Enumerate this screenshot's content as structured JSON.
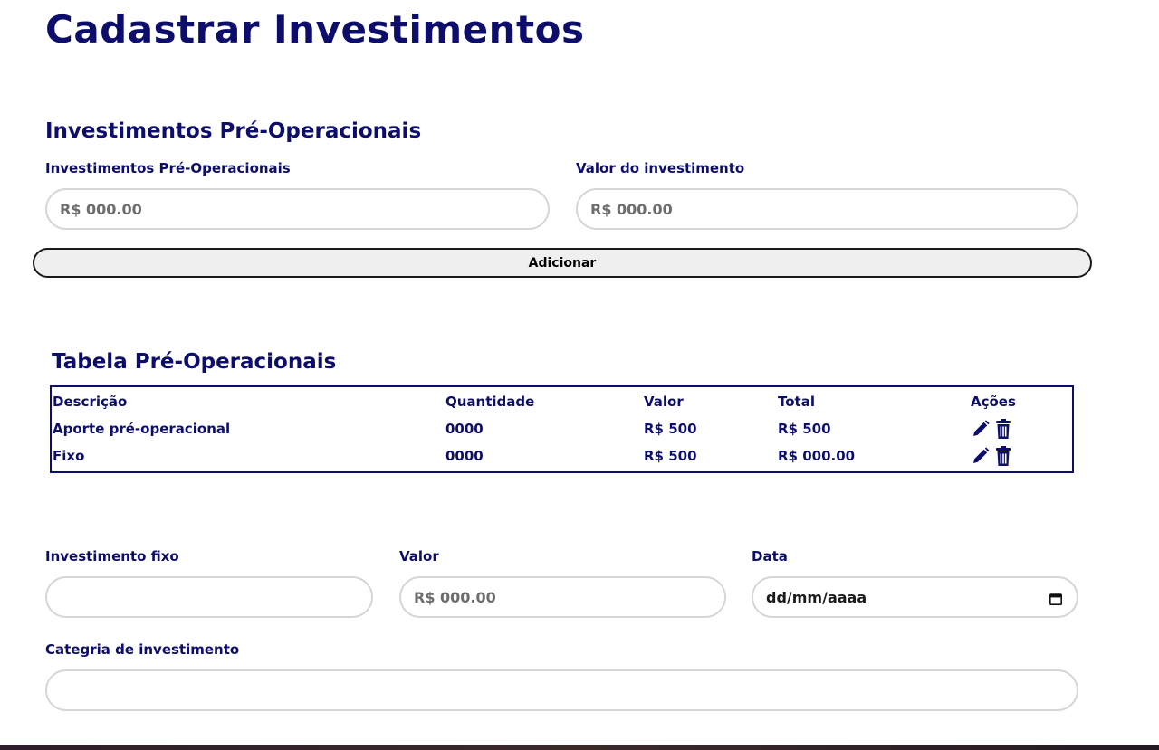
{
  "page": {
    "title": "Cadastrar Investimentos"
  },
  "pre_operacional": {
    "section_title": "Investimentos Pré-Operacionais",
    "description_label": "Investimentos Pré-Operacionais",
    "description_placeholder": "R$ 000.00",
    "value_label": "Valor do investimento",
    "value_placeholder": "R$ 000.00",
    "add_button_label": "Adicionar"
  },
  "table": {
    "title": "Tabela Pré-Operacionais",
    "headers": [
      "Descrição",
      "Quantidade",
      "Valor",
      "Total",
      "Ações"
    ],
    "rows": [
      {
        "descricao": "Aporte pré-operacional",
        "quantidade": "0000",
        "valor": "R$ 500",
        "total": "R$ 500"
      },
      {
        "descricao": "Fixo",
        "quantidade": "0000",
        "valor": "R$ 500",
        "total": "R$ 000.00"
      }
    ],
    "action_icons": [
      "pencil-icon",
      "trash-icon"
    ]
  },
  "fixo": {
    "name_label": "Investimento fixo",
    "name_value": "",
    "value_label": "Valor",
    "value_placeholder": "R$ 000.00",
    "date_label": "Data",
    "date_placeholder": "dd/mm/aaaa",
    "date_icon": "calendar-icon",
    "category_label": "Categria de investimento",
    "category_value": ""
  },
  "colors": {
    "primary": "#0d0d6b",
    "input_border": "#d6d6d6",
    "button_bg": "#efefef",
    "button_border": "#1a1a1a"
  }
}
